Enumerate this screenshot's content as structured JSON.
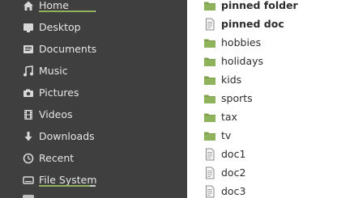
{
  "colors": {
    "sidebar_bg": "#3f3f3f",
    "sidebar_text": "#e6e6e6",
    "usage_bar": "#8fb35a",
    "folder_green": "#8fb35a",
    "file_text": "#2d2d2d"
  },
  "sidebar": {
    "items": [
      {
        "label": "Home",
        "icon": "home-icon",
        "usage_fraction": 0.98
      },
      {
        "label": "Desktop",
        "icon": "desktop-icon"
      },
      {
        "label": "Documents",
        "icon": "documents-icon"
      },
      {
        "label": "Music",
        "icon": "music-icon"
      },
      {
        "label": "Pictures",
        "icon": "camera-icon"
      },
      {
        "label": "Videos",
        "icon": "film-icon"
      },
      {
        "label": "Downloads",
        "icon": "download-icon"
      },
      {
        "label": "Recent",
        "icon": "clock-icon"
      },
      {
        "label": "File System",
        "icon": "drive-icon",
        "usage_fraction": 0.9
      }
    ]
  },
  "files": [
    {
      "name": "pinned folder",
      "type": "folder",
      "pinned": true
    },
    {
      "name": "pinned doc",
      "type": "document",
      "pinned": true
    },
    {
      "name": "hobbies",
      "type": "folder"
    },
    {
      "name": "holidays",
      "type": "folder"
    },
    {
      "name": "kids",
      "type": "folder"
    },
    {
      "name": "sports",
      "type": "folder"
    },
    {
      "name": "tax",
      "type": "folder"
    },
    {
      "name": "tv",
      "type": "folder"
    },
    {
      "name": "doc1",
      "type": "document"
    },
    {
      "name": "doc2",
      "type": "document"
    },
    {
      "name": "doc3",
      "type": "document"
    }
  ]
}
